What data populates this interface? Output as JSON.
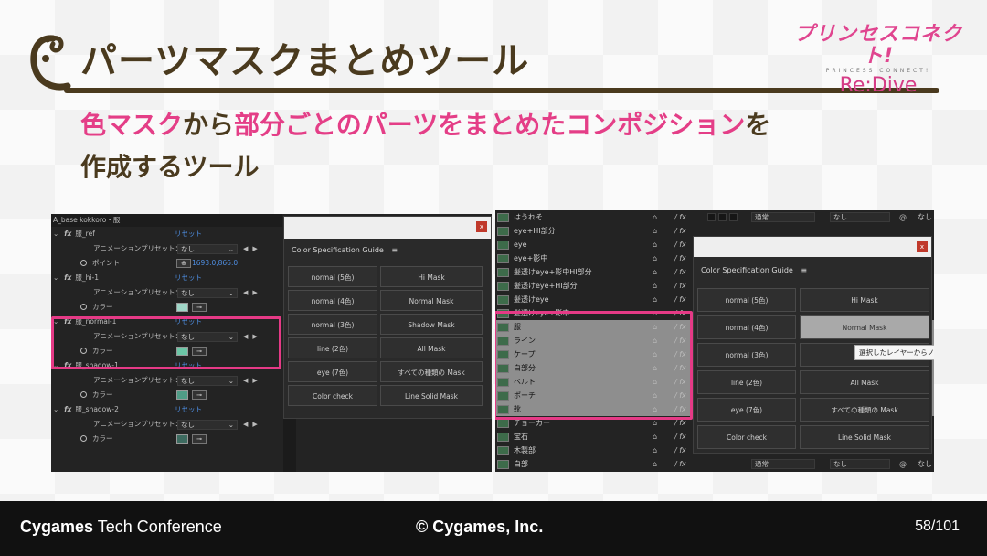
{
  "slide": {
    "title": "パーツマスクまとめツール",
    "subtitle_line1_parts": [
      {
        "text": "色マスク",
        "pink": true
      },
      {
        "text": "から",
        "pink": false
      },
      {
        "text": "部分ごとのパーツをまとめたコンポジション",
        "pink": true
      },
      {
        "text": "を",
        "pink": false
      }
    ],
    "subtitle_line2": "作成するツール"
  },
  "logo": {
    "main": "プリンセスコネクト!",
    "sub": "PRINCESS CONNECT!",
    "re": "Re:Dive"
  },
  "left_screenshot": {
    "comp_header": "A_base kokkoro・服",
    "groups": [
      {
        "name": "服_ref",
        "reset": "リセット",
        "preset_label": "アニメーションプリセット：",
        "preset_value": "なし",
        "prop_label": "ポイント",
        "prop_value": "1693.0,866.0",
        "kind": "point"
      },
      {
        "name": "服_hi-1",
        "reset": "リセット",
        "preset_label": "アニメーションプリセット：",
        "preset_value": "なし",
        "prop_label": "カラー",
        "swatch": "#9fd6c7",
        "kind": "color"
      },
      {
        "name": "服_normal-1",
        "reset": "リセット",
        "preset_label": "アニメーションプリセット：",
        "preset_value": "なし",
        "prop_label": "カラー",
        "swatch": "#6cc6a6",
        "kind": "color"
      },
      {
        "name": "服_shadow-1",
        "reset": "リセット",
        "preset_label": "アニメーションプリセット：",
        "preset_value": "なし",
        "prop_label": "カラー",
        "swatch": "#4f9c86",
        "kind": "color"
      },
      {
        "name": "服_shadow-2",
        "reset": "リセット",
        "preset_label": "アニメーションプリセット：",
        "preset_value": "なし",
        "prop_label": "カラー",
        "swatch": "#3d6b60",
        "kind": "color"
      }
    ],
    "panel": {
      "title": "Color Specification Guide",
      "menu_icon": "≡",
      "close": "x",
      "buttons": [
        "normal (5色)",
        "Hi Mask",
        "normal (4色)",
        "Normal Mask",
        "normal (3色)",
        "Shadow Mask",
        "line (2色)",
        "All Mask",
        "eye (7色)",
        "すべての種類の Mask",
        "Color check",
        "Line Solid Mask"
      ]
    }
  },
  "right_screenshot": {
    "layers": [
      {
        "name": "はうれそ",
        "selected": false,
        "mode": "通常",
        "trk": "なし"
      },
      {
        "name": "eye+HI部分",
        "selected": false
      },
      {
        "name": "eye",
        "selected": false
      },
      {
        "name": "eye+影中",
        "selected": false
      },
      {
        "name": "髪透けeye+影中HI部分",
        "selected": false
      },
      {
        "name": "髪透けeye+HI部分",
        "selected": false
      },
      {
        "name": "髪透けeye",
        "selected": false
      },
      {
        "name": "髪透けeye+影中",
        "selected": false
      },
      {
        "name": "服",
        "selected": true
      },
      {
        "name": "ライン",
        "selected": true
      },
      {
        "name": "ケープ",
        "selected": true
      },
      {
        "name": "白部分",
        "selected": true
      },
      {
        "name": "ベルト",
        "selected": true
      },
      {
        "name": "ポーチ",
        "selected": true
      },
      {
        "name": "靴",
        "selected": true
      },
      {
        "name": "チョーカー",
        "selected": false
      },
      {
        "name": "宝石",
        "selected": false
      },
      {
        "name": "木製部",
        "selected": false
      },
      {
        "name": "白部",
        "selected": false,
        "mode": "通常",
        "trk": "なし"
      }
    ],
    "top_mode": "通常",
    "top_trk": "なし",
    "top_nashi": "なし",
    "bottom_mode": "通常",
    "bottom_trk": "なし",
    "bottom_nashi": "なし",
    "panel": {
      "title": "Color Specification Guide",
      "menu_icon": "≡",
      "close": "x",
      "buttons": [
        "normal (5色)",
        "Hi Mask",
        "normal (4色)",
        "Normal Mask",
        "normal (3色)",
        "Shac",
        "line (2色)",
        "All Mask",
        "eye (7色)",
        "すべての種類の Mask",
        "Color check",
        "Line Solid Mask"
      ],
      "active_index": 3,
      "tooltip": "選択したレイヤーからノ"
    }
  },
  "footer": {
    "brand_bold": "Cygames",
    "brand_rest": " Tech Conference",
    "copyright": "© Cygames, Inc.",
    "page": "58/101"
  },
  "colors": {
    "accent_pink": "#e43e87",
    "title_brown": "#4a3a1e",
    "highlight": "#e53a86"
  }
}
